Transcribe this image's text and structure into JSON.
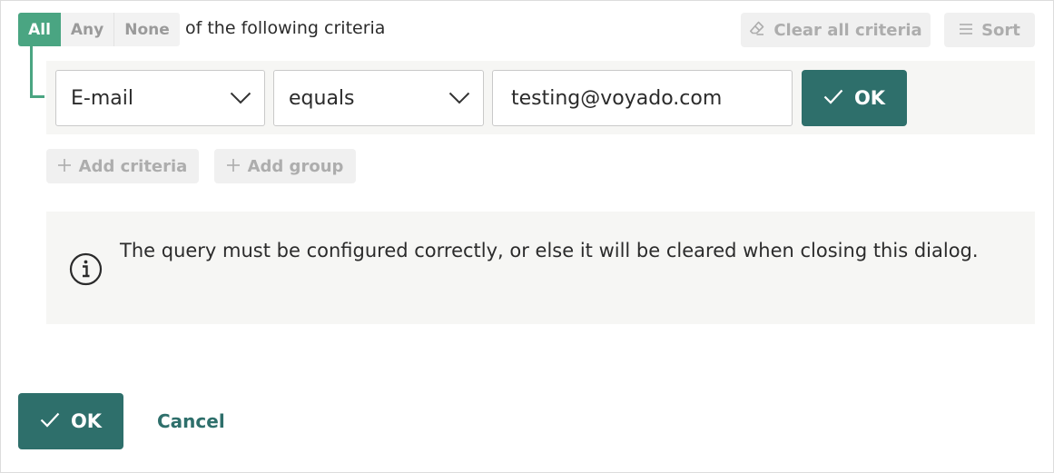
{
  "match": {
    "options": [
      "All",
      "Any",
      "None"
    ],
    "selected": "All",
    "suffix": "of the following criteria"
  },
  "toolbar": {
    "clear_label": "Clear all criteria",
    "sort_label": "Sort"
  },
  "criterion": {
    "field": "E-mail",
    "operator": "equals",
    "value": "testing@voyado.com",
    "ok_label": "OK"
  },
  "actions": {
    "add_criteria_label": "Add criteria",
    "add_group_label": "Add group"
  },
  "info": {
    "message": "The query must be configured correctly, or else it will be cleared when closing this dialog."
  },
  "footer": {
    "ok_label": "OK",
    "cancel_label": "Cancel"
  },
  "colors": {
    "accent_green": "#4aa582",
    "primary_teal": "#2e6f6b",
    "disabled_gray": "#adadad",
    "panel_bg": "#f6f6f4"
  },
  "icons": {
    "clear": "eraser-icon",
    "sort": "sort-lines-icon",
    "dropdown": "chevron-down-icon",
    "confirm": "check-icon",
    "add": "plus-icon",
    "info": "info-circle-icon"
  }
}
